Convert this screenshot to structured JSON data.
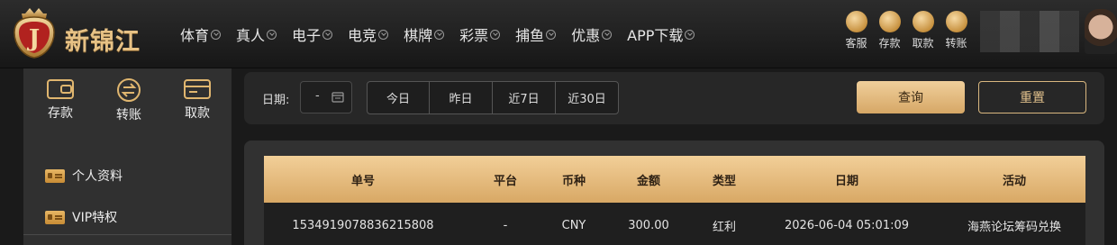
{
  "brand": {
    "name": "新锦江",
    "badge_letter": "J"
  },
  "nav": [
    {
      "label": "体育"
    },
    {
      "label": "真人"
    },
    {
      "label": "电子"
    },
    {
      "label": "电竞"
    },
    {
      "label": "棋牌"
    },
    {
      "label": "彩票"
    },
    {
      "label": "捕鱼"
    },
    {
      "label": "优惠"
    },
    {
      "label": "APP下载"
    }
  ],
  "top_actions": [
    {
      "label": "客服",
      "icon": "headset-icon"
    },
    {
      "label": "存款",
      "icon": "deposit-card-icon"
    },
    {
      "label": "取款",
      "icon": "withdraw-icon"
    },
    {
      "label": "转账",
      "icon": "transfer-icon"
    }
  ],
  "sidebar": {
    "quick": [
      {
        "label": "存款",
        "icon": "wallet-icon"
      },
      {
        "label": "转账",
        "icon": "transfer-circle-icon"
      },
      {
        "label": "取款",
        "icon": "card-icon"
      }
    ],
    "menu": [
      {
        "label": "个人资料",
        "icon": "id-card-icon"
      },
      {
        "label": "VIP特权",
        "icon": "vip-card-icon"
      }
    ]
  },
  "filter": {
    "date_label": "日期:",
    "date_value": "-",
    "ranges": [
      "今日",
      "昨日",
      "近7日",
      "近30日"
    ],
    "query_label": "查询",
    "reset_label": "重置"
  },
  "table": {
    "headers": [
      "单号",
      "平台",
      "币种",
      "金额",
      "类型",
      "日期",
      "活动"
    ],
    "rows": [
      [
        "1534919078836215808",
        "-",
        "CNY",
        "300.00",
        "红利",
        "2026-06-04 05:01:09",
        "海燕论坛筹码兑换"
      ]
    ]
  },
  "colors": {
    "gold": "#e2bd7d",
    "panel": "#313131",
    "background": "#1a1a1a"
  }
}
